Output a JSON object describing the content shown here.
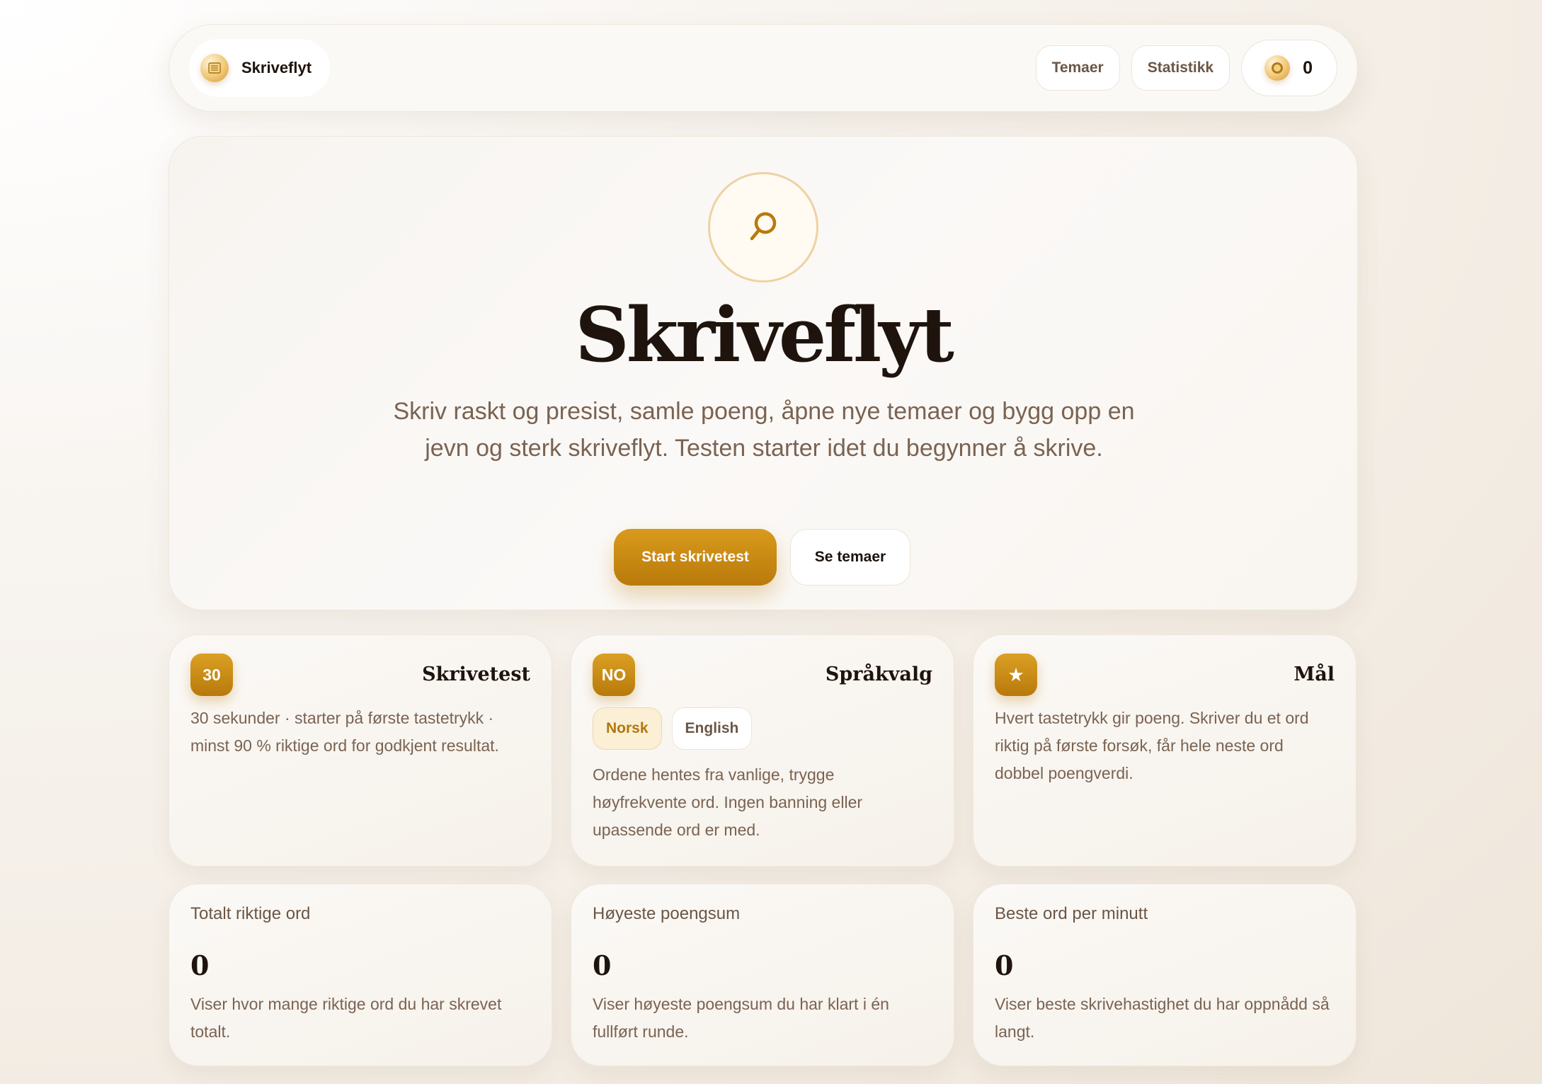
{
  "nav": {
    "brand_name": "Skriveflyt",
    "brand_icon": "document-icon",
    "themes_label": "Temaer",
    "stats_label": "Statistikk",
    "coin_icon": "coin-icon",
    "coin_count": "0"
  },
  "hero": {
    "icon": "search-icon",
    "title": "Skriveflyt",
    "subtitle": "Skriv raskt og presist, samle poeng, åpne nye temaer og bygg opp en jevn og sterk skriveflyt. Testen starter idet du begynner å skrive.",
    "primary_button": "Start skrivetest",
    "secondary_button": "Se temaer"
  },
  "cards": [
    {
      "badge": "30",
      "title": "Skrivetest",
      "text": "30 sekunder · starter på første tastetrykk · minst 90 % riktige ord for godkjent resultat."
    },
    {
      "badge": "NO",
      "title": "Språkvalg",
      "languages": [
        "Norsk",
        "English"
      ],
      "selected_language": "Norsk",
      "text": "Ordene hentes fra vanlige, trygge høyfrekvente ord. Ingen banning eller upassende ord er med."
    },
    {
      "badge": "★",
      "title": "Mål",
      "text": "Hvert tastetrykk gir poeng. Skriver du et ord riktig på første forsøk, får hele neste ord dobbel poengverdi."
    }
  ],
  "stats": [
    {
      "label": "Totalt riktige ord",
      "value": "0",
      "desc": "Viser hvor mange riktige ord du har skrevet totalt."
    },
    {
      "label": "Høyeste poengsum",
      "value": "0",
      "desc": "Viser høyeste poengsum du har klart i én fullført runde."
    },
    {
      "label": "Beste ord per minutt",
      "value": "0",
      "desc": "Viser beste skrivehastighet du har oppnådd så langt."
    }
  ],
  "colors": {
    "accent": "#c98a12",
    "background": "#f4eee6",
    "text": "#1e140d",
    "muted": "#7a6352"
  }
}
